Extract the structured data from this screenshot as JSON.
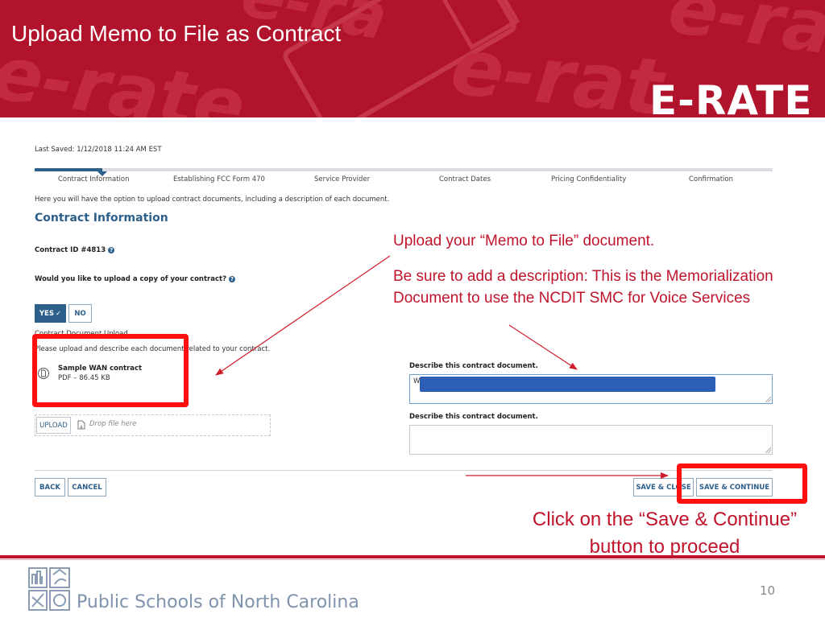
{
  "slide": {
    "title": "Upload Memo to File as Contract",
    "logo_text": "E-RATE",
    "page_number": "10",
    "footer_text": "Public Schools of North Carolina"
  },
  "form": {
    "last_saved": "Last Saved: 1/12/2018 11:24 AM EST",
    "steps": [
      "Contract Information",
      "Establishing FCC Form 470",
      "Service Provider",
      "Contract Dates",
      "Pricing Confidentiality",
      "Confirmation"
    ],
    "intro": "Here you will have the option to upload contract documents, including a description of each document.",
    "section_title": "Contract Information",
    "contract_id": "Contract ID #4813",
    "upload_question": "Would you like to upload a copy of your contract?",
    "yes_label": "YES",
    "no_label": "NO",
    "upload_section_label": "Contract Document Upload",
    "upload_instructions": "Please upload and describe each document related to your contract.",
    "file_name": "Sample WAN contract",
    "file_meta": "PDF – 86.45 KB",
    "upload_button": "UPLOAD",
    "drop_placeholder": "Drop file here",
    "describe_label_1": "Describe this contract document.",
    "describe_value_1": "W",
    "describe_label_2": "Describe this contract document.",
    "back_button": "BACK",
    "cancel_button": "CANCEL",
    "save_close_button": "SAVE & CLOSE",
    "save_continue_button": "SAVE & CONTINUE"
  },
  "annotations": {
    "upload_note": "Upload your “Memo to File” document.",
    "description_note": "Be sure to add a description:  This is the Memorialization Document to use the NCDIT SMC for Voice Services",
    "save_note": "Click on the “Save & Continue” button to proceed"
  },
  "colors": {
    "banner": "#b0132b",
    "brand_blue": "#2d5f8b",
    "annotation_red": "#c0142c",
    "highlight_box": "#ff1010"
  }
}
